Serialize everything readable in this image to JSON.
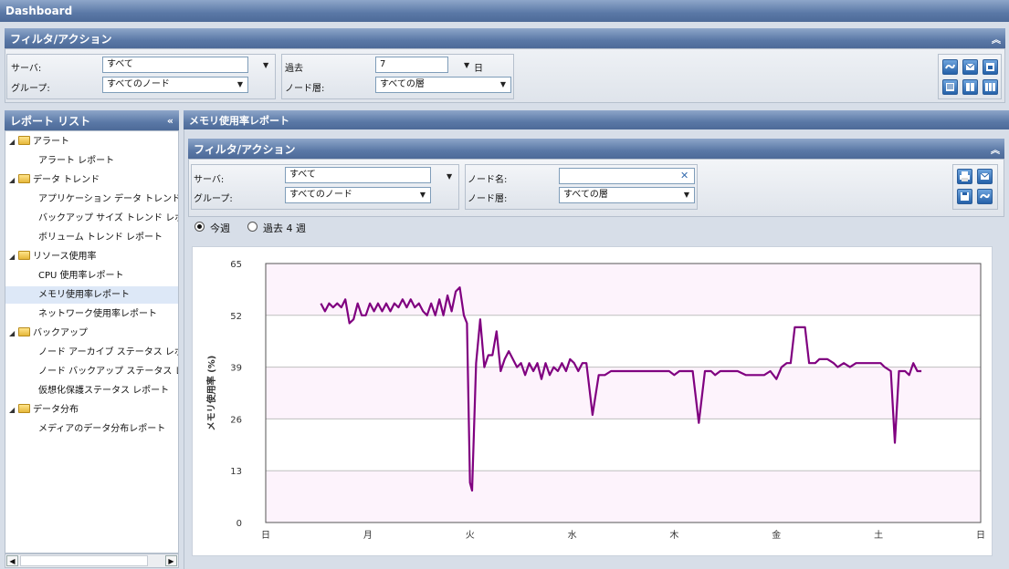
{
  "app_title": "Dashboard",
  "top_filter": {
    "title": "フィルタ/アクション",
    "server_label": "サーバ:",
    "server_value": "すべて",
    "group_label": "グループ:",
    "group_value": "すべてのノード",
    "past_label": "過去",
    "past_value": "7",
    "day_unit": "日",
    "node_layer_label": "ノード層:",
    "node_layer_value": "すべての層"
  },
  "sidebar": {
    "title": "レポート リスト",
    "items": [
      {
        "type": "folder",
        "label": "アラート"
      },
      {
        "type": "report",
        "label": "アラート レポート"
      },
      {
        "type": "folder",
        "label": "データ トレンド"
      },
      {
        "type": "report",
        "label": "アプリケーション データ トレンド レポート"
      },
      {
        "type": "report",
        "label": "バックアップ サイズ トレンド レポート"
      },
      {
        "type": "report",
        "label": "ボリューム トレンド レポート"
      },
      {
        "type": "folder",
        "label": "リソース使用率"
      },
      {
        "type": "report",
        "label": "CPU 使用率レポート"
      },
      {
        "type": "report",
        "label": "メモリ使用率レポート",
        "selected": true
      },
      {
        "type": "report",
        "label": "ネットワーク使用率レポート"
      },
      {
        "type": "folder",
        "label": "バックアップ"
      },
      {
        "type": "report",
        "label": "ノード アーカイブ ステータス レポート"
      },
      {
        "type": "report",
        "label": "ノード バックアップ ステータス レポート"
      },
      {
        "type": "report",
        "label": "仮想化保護ステータス レポート"
      },
      {
        "type": "folder",
        "label": "データ分布"
      },
      {
        "type": "report",
        "label": "メディアのデータ分布レポート"
      }
    ]
  },
  "report": {
    "title": "メモリ使用率レポート",
    "filter_title": "フィルタ/アクション",
    "server_label": "サーバ:",
    "server_value": "すべて",
    "group_label": "グループ:",
    "group_value": "すべてのノード",
    "node_name_label": "ノード名:",
    "node_name_value": "",
    "node_layer_label": "ノード層:",
    "node_layer_value": "すべての層",
    "radio_this_week": "今週",
    "radio_past_4": "過去 4 週"
  },
  "colors": {
    "line": "#800080",
    "header": "#5a78a6"
  },
  "chart_data": {
    "type": "line",
    "ylabel": "メモリ使用率 (%)",
    "ylim": [
      0,
      65
    ],
    "yticks": [
      "65",
      "52",
      "39",
      "26",
      "13",
      "0"
    ],
    "xticks": [
      "日",
      "月",
      "火",
      "水",
      "木",
      "金",
      "土",
      "日"
    ],
    "xlim": [
      0,
      7
    ],
    "series": [
      {
        "values": [
          [
            0.54,
            55
          ],
          [
            0.58,
            53
          ],
          [
            0.62,
            55
          ],
          [
            0.66,
            54
          ],
          [
            0.7,
            55
          ],
          [
            0.74,
            54
          ],
          [
            0.78,
            56
          ],
          [
            0.82,
            50
          ],
          [
            0.86,
            51
          ],
          [
            0.9,
            55
          ],
          [
            0.94,
            52
          ],
          [
            0.98,
            52
          ],
          [
            1.02,
            55
          ],
          [
            1.06,
            53
          ],
          [
            1.1,
            55
          ],
          [
            1.14,
            53
          ],
          [
            1.18,
            55
          ],
          [
            1.22,
            53
          ],
          [
            1.26,
            55
          ],
          [
            1.3,
            54
          ],
          [
            1.34,
            56
          ],
          [
            1.38,
            54
          ],
          [
            1.42,
            56
          ],
          [
            1.46,
            54
          ],
          [
            1.5,
            55
          ],
          [
            1.54,
            53
          ],
          [
            1.58,
            52
          ],
          [
            1.62,
            55
          ],
          [
            1.66,
            52
          ],
          [
            1.7,
            56
          ],
          [
            1.74,
            52
          ],
          [
            1.78,
            57
          ],
          [
            1.82,
            53
          ],
          [
            1.86,
            58
          ],
          [
            1.9,
            59
          ],
          [
            1.94,
            52
          ],
          [
            1.97,
            50
          ],
          [
            2.0,
            10
          ],
          [
            2.02,
            8
          ],
          [
            2.06,
            40
          ],
          [
            2.1,
            51
          ],
          [
            2.14,
            39
          ],
          [
            2.18,
            42
          ],
          [
            2.22,
            42
          ],
          [
            2.26,
            48
          ],
          [
            2.3,
            38
          ],
          [
            2.34,
            41
          ],
          [
            2.38,
            43
          ],
          [
            2.42,
            41
          ],
          [
            2.46,
            39
          ],
          [
            2.5,
            40
          ],
          [
            2.54,
            37
          ],
          [
            2.58,
            40
          ],
          [
            2.62,
            38
          ],
          [
            2.66,
            40
          ],
          [
            2.7,
            36
          ],
          [
            2.74,
            40
          ],
          [
            2.78,
            37
          ],
          [
            2.82,
            39
          ],
          [
            2.86,
            38
          ],
          [
            2.9,
            40
          ],
          [
            2.94,
            38
          ],
          [
            2.98,
            41
          ],
          [
            3.02,
            40
          ],
          [
            3.06,
            38
          ],
          [
            3.1,
            40
          ],
          [
            3.14,
            40
          ],
          [
            3.2,
            27
          ],
          [
            3.26,
            37
          ],
          [
            3.32,
            37
          ],
          [
            3.38,
            38
          ],
          [
            3.45,
            38
          ],
          [
            3.55,
            38
          ],
          [
            3.7,
            38
          ],
          [
            3.85,
            38
          ],
          [
            3.95,
            38
          ],
          [
            4.0,
            37
          ],
          [
            4.05,
            38
          ],
          [
            4.1,
            38
          ],
          [
            4.15,
            38
          ],
          [
            4.18,
            38
          ],
          [
            4.24,
            25
          ],
          [
            4.3,
            38
          ],
          [
            4.36,
            38
          ],
          [
            4.4,
            37
          ],
          [
            4.45,
            38
          ],
          [
            4.55,
            38
          ],
          [
            4.62,
            38
          ],
          [
            4.7,
            37
          ],
          [
            4.8,
            37
          ],
          [
            4.88,
            37
          ],
          [
            4.94,
            38
          ],
          [
            5.0,
            36
          ],
          [
            5.05,
            39
          ],
          [
            5.1,
            40
          ],
          [
            5.14,
            40
          ],
          [
            5.18,
            49
          ],
          [
            5.24,
            49
          ],
          [
            5.28,
            49
          ],
          [
            5.32,
            40
          ],
          [
            5.38,
            40
          ],
          [
            5.42,
            41
          ],
          [
            5.5,
            41
          ],
          [
            5.56,
            40
          ],
          [
            5.6,
            39
          ],
          [
            5.66,
            40
          ],
          [
            5.72,
            39
          ],
          [
            5.78,
            40
          ],
          [
            5.84,
            40
          ],
          [
            5.9,
            40
          ],
          [
            5.96,
            40
          ],
          [
            6.02,
            40
          ],
          [
            6.06,
            39
          ],
          [
            6.12,
            38
          ],
          [
            6.16,
            20
          ],
          [
            6.2,
            38
          ],
          [
            6.26,
            38
          ],
          [
            6.3,
            37
          ],
          [
            6.34,
            40
          ],
          [
            6.38,
            38
          ],
          [
            6.42,
            38
          ]
        ]
      }
    ]
  }
}
